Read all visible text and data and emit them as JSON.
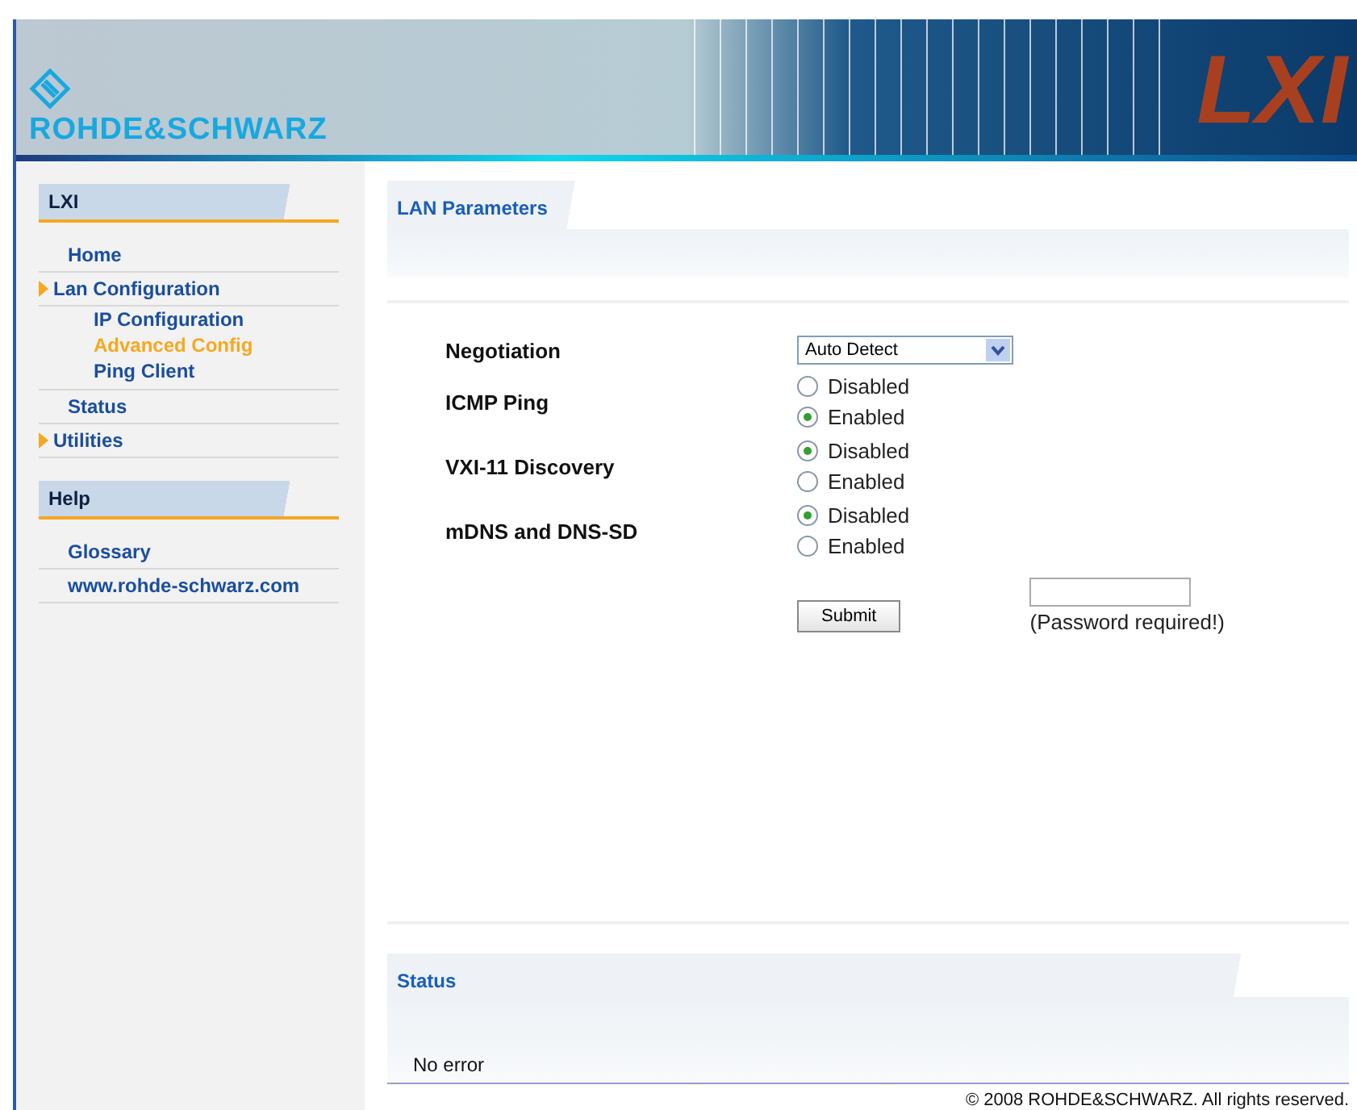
{
  "header": {
    "logo": "ROHDE&SCHWARZ",
    "badge": "LXI"
  },
  "sidebar": {
    "sections": [
      {
        "title": "LXI",
        "items": [
          {
            "label": "Home",
            "kind": "page",
            "selected": false
          },
          {
            "label": "Lan Configuration",
            "kind": "folder",
            "selected": false,
            "children": [
              {
                "label": "IP Configuration",
                "selected": false
              },
              {
                "label": "Advanced Config",
                "selected": true
              },
              {
                "label": "Ping Client",
                "selected": false
              }
            ]
          },
          {
            "label": "Status",
            "kind": "page",
            "selected": false
          },
          {
            "label": "Utilities",
            "kind": "folder",
            "selected": false
          }
        ]
      },
      {
        "title": "Help",
        "items": [
          {
            "label": "Glossary",
            "kind": "page",
            "selected": false
          },
          {
            "label": "www.rohde-schwarz.com",
            "kind": "page",
            "selected": false
          }
        ]
      }
    ]
  },
  "panel": {
    "title": "LAN Parameters",
    "rows": [
      {
        "label": "Negotiation",
        "kind": "select",
        "value": "Auto Detect"
      },
      {
        "label": "ICMP Ping",
        "kind": "radio",
        "options": [
          {
            "label": "Disabled",
            "selected": false
          },
          {
            "label": "Enabled",
            "selected": true
          }
        ]
      },
      {
        "label": "VXI-11 Discovery",
        "kind": "radio",
        "options": [
          {
            "label": "Disabled",
            "selected": true
          },
          {
            "label": "Enabled",
            "selected": false
          }
        ]
      },
      {
        "label": "mDNS and DNS-SD",
        "kind": "radio",
        "options": [
          {
            "label": "Disabled",
            "selected": true
          },
          {
            "label": "Enabled",
            "selected": false
          }
        ]
      }
    ],
    "submit": "Submit",
    "password_note": "(Password required!)"
  },
  "status": {
    "title": "Status",
    "message": "No error"
  },
  "footer": "© 2008 ROHDE&SCHWARZ. All rights reserved."
}
